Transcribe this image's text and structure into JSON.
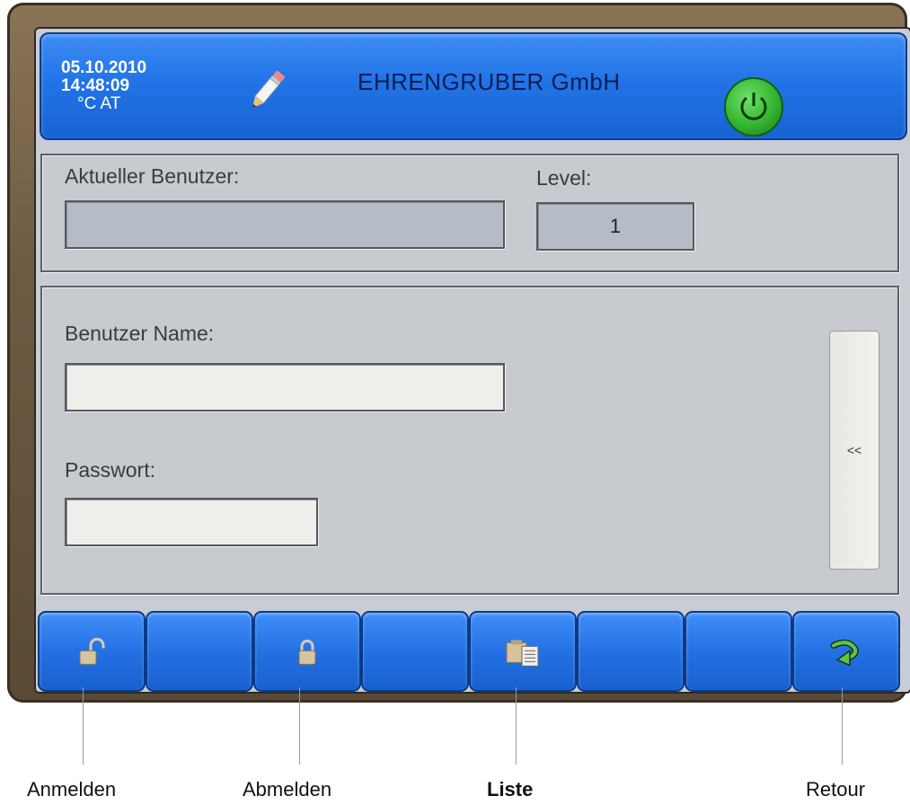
{
  "header": {
    "date": "05.10.2010",
    "time": "14:48:09",
    "unit": "°C AT",
    "company": "EHRENGRUBER GmbH",
    "power_icon": "power-icon",
    "edit_icon": "pencil-icon"
  },
  "user_panel": {
    "current_user_label": "Aktueller Benutzer:",
    "current_user_value": "",
    "level_label": "Level:",
    "level_value": "1"
  },
  "login_panel": {
    "username_label": "Benutzer Name:",
    "username_value": "",
    "password_label": "Passwort:",
    "password_value": "",
    "side_button": "<<"
  },
  "toolbar": {
    "buttons": [
      {
        "icon": "unlock-icon",
        "label": "Anmelden"
      },
      {
        "icon": "",
        "label": ""
      },
      {
        "icon": "lock-icon",
        "label": "Abmelden"
      },
      {
        "icon": "",
        "label": ""
      },
      {
        "icon": "list-icon",
        "label": "Liste"
      },
      {
        "icon": "",
        "label": ""
      },
      {
        "icon": "",
        "label": ""
      },
      {
        "icon": "return-arrow-icon",
        "label": "Retour"
      }
    ]
  },
  "callouts": {
    "anmelden": "Anmelden",
    "abmelden": "Abmelden",
    "liste": "Liste",
    "retour": "Retour"
  },
  "colors": {
    "header_blue": "#2274e6",
    "panel_grey": "#c7cace",
    "power_green": "#33b52f",
    "bezel_brown": "#6d5a43"
  }
}
